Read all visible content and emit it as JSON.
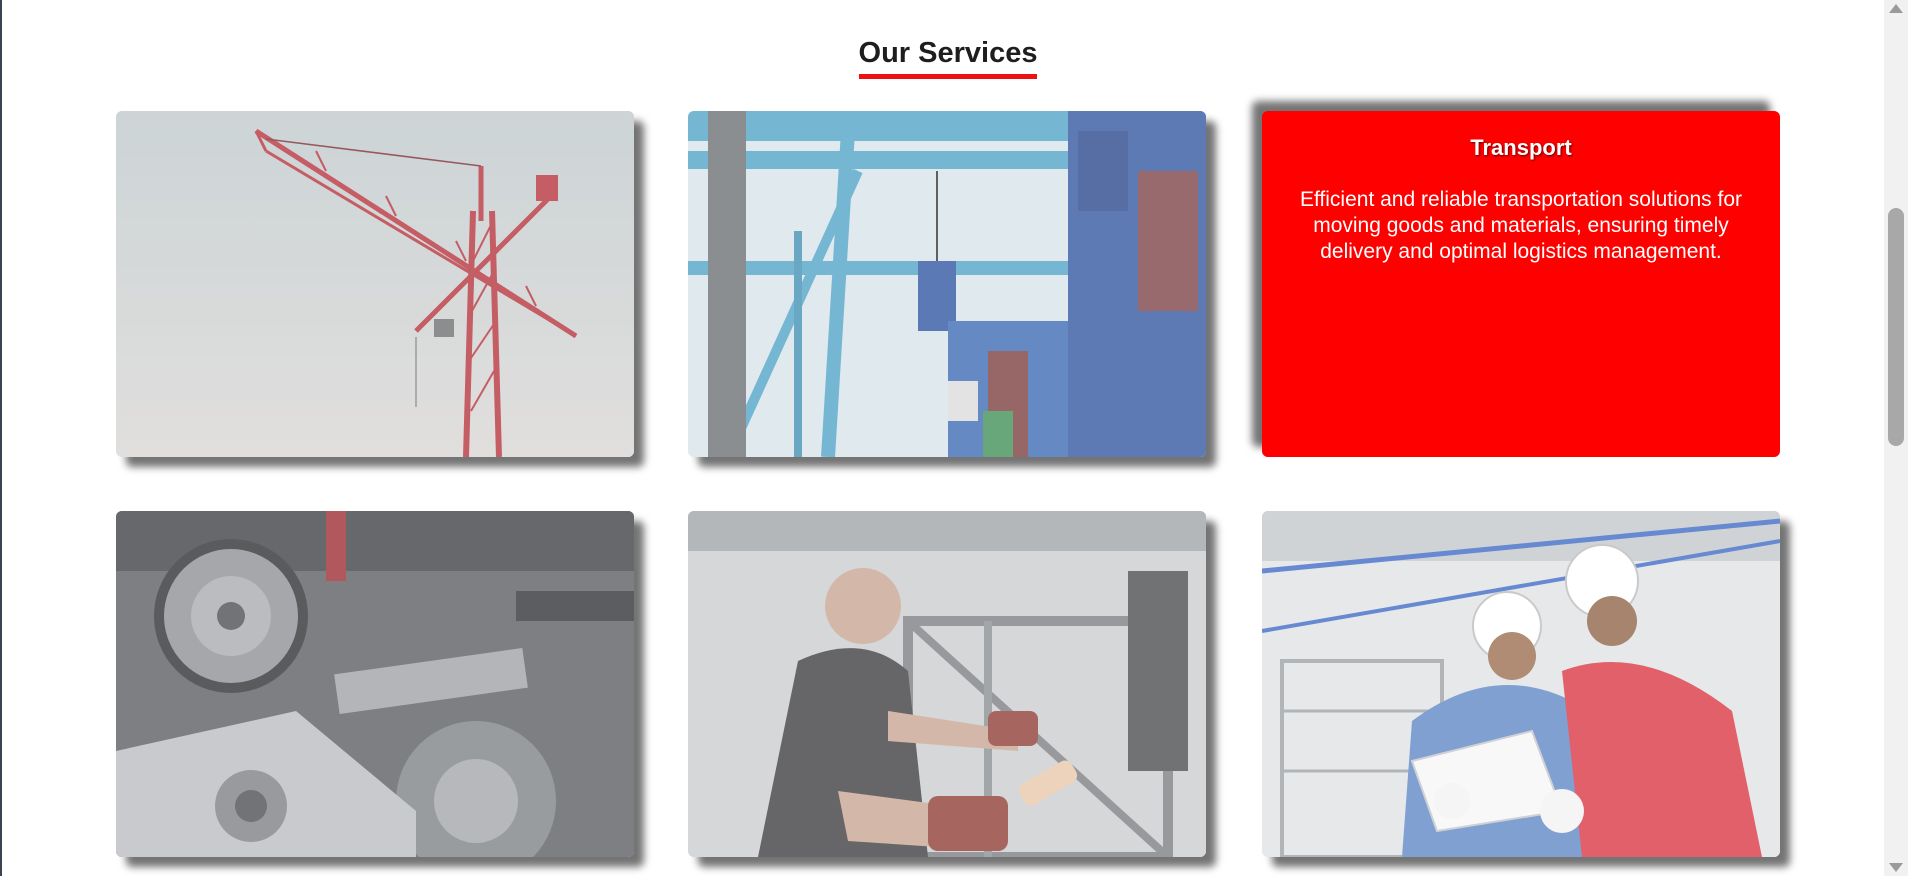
{
  "section": {
    "title": "Our Services"
  },
  "transport_card": {
    "title": "Transport",
    "description": "Efficient and reliable transportation solutions for moving goods and materials, ensuring timely delivery and optimal logistics management."
  },
  "colors": {
    "accent": "#ff0000",
    "title_underline": "#ee1111",
    "background": "#ffffff"
  },
  "images": [
    "tower-crane-image",
    "port-containers-image",
    "engine-belt-image",
    "metal-worker-image",
    "engineers-blueprint-image"
  ]
}
